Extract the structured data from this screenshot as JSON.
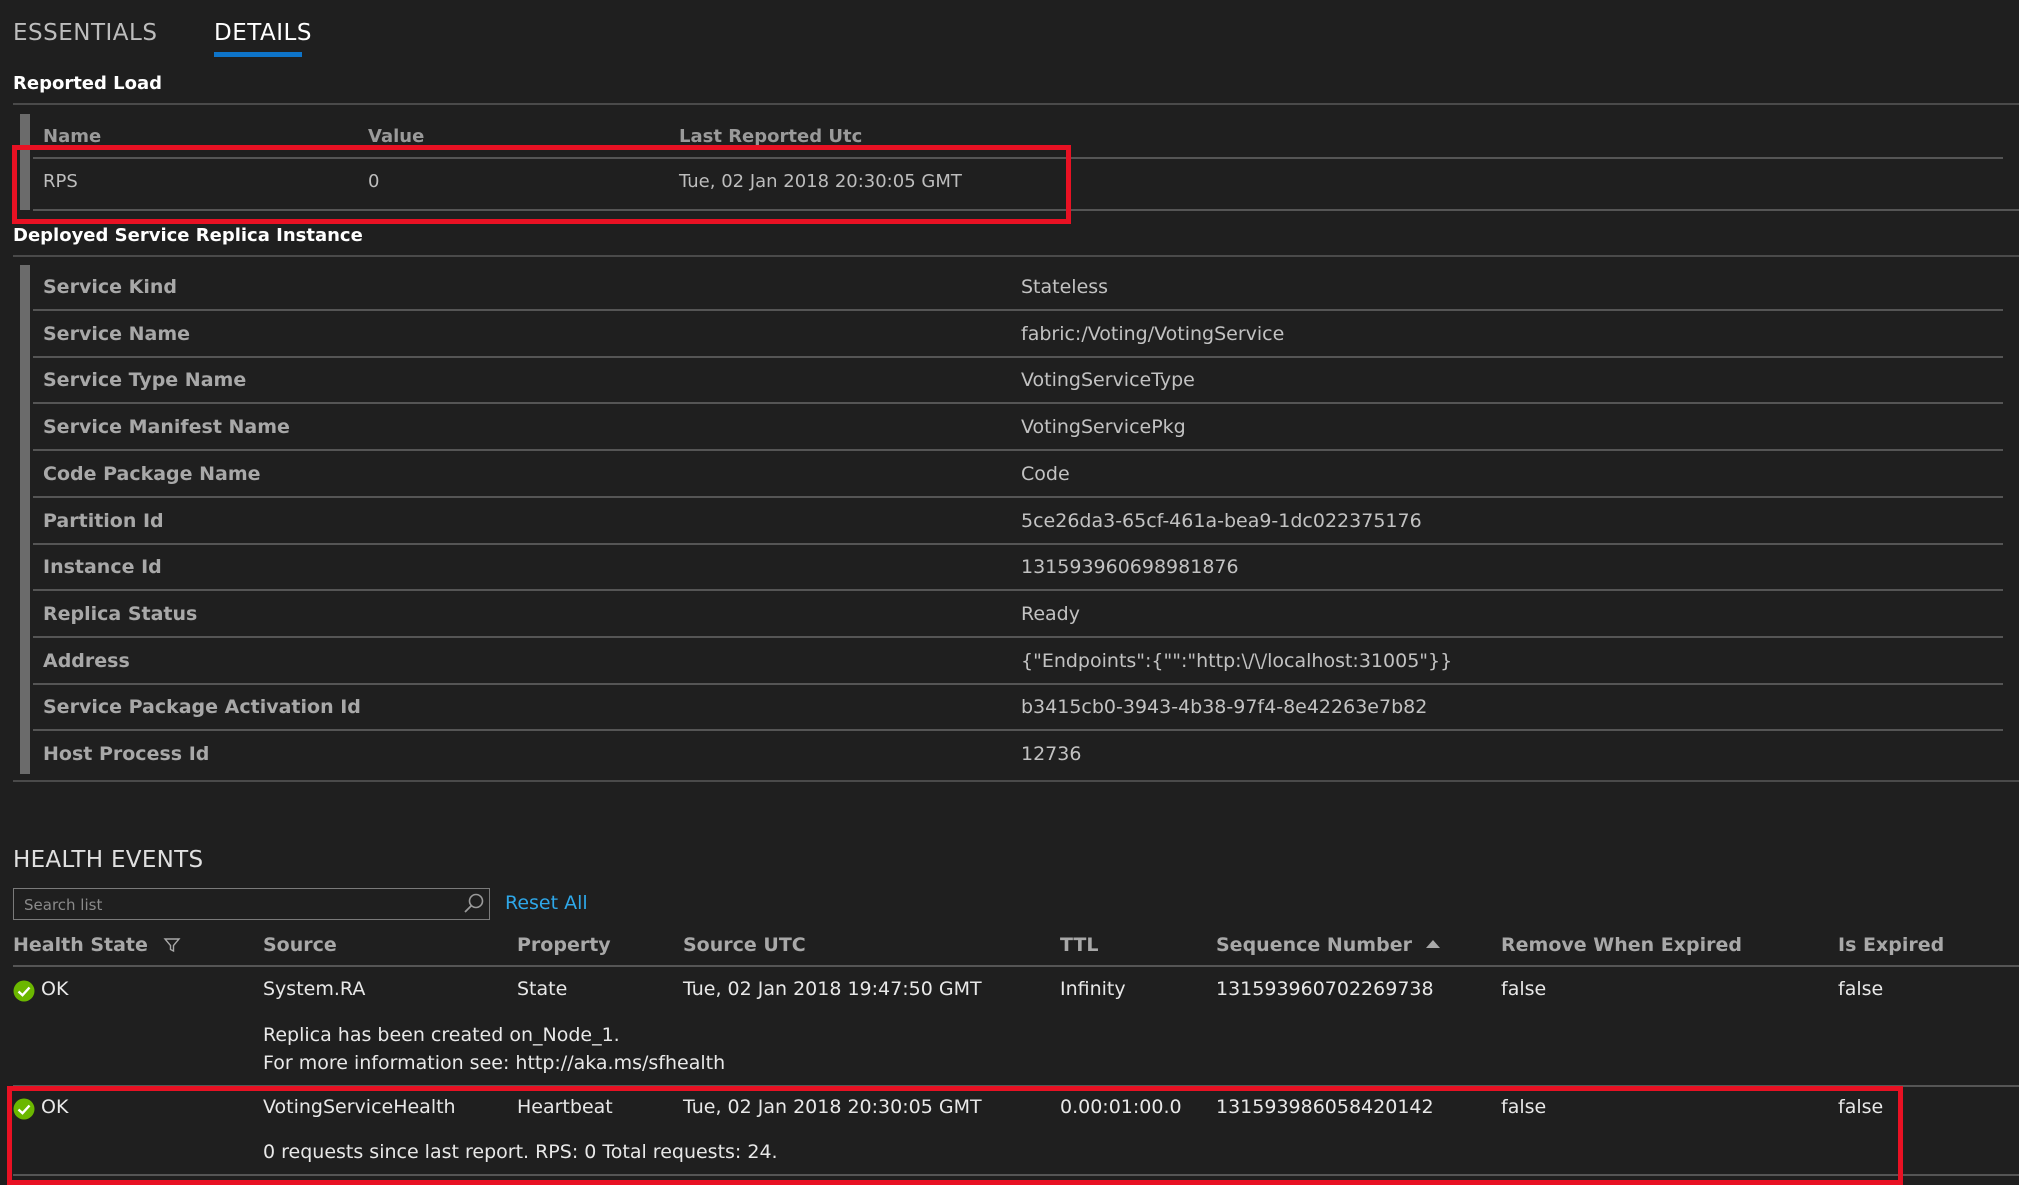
{
  "tabs": {
    "essentials": "ESSENTIALS",
    "details": "DETAILS"
  },
  "reported_load": {
    "title": "Reported Load",
    "headers": [
      "Name",
      "Value",
      "Last Reported Utc"
    ],
    "row": {
      "name": "RPS",
      "value": "0",
      "last_reported": "Tue, 02 Jan 2018 20:30:05 GMT"
    }
  },
  "replica": {
    "title": "Deployed Service Replica Instance",
    "rows": [
      {
        "key": "Service Kind",
        "value": "Stateless"
      },
      {
        "key": "Service Name",
        "value": "fabric:/Voting/VotingService"
      },
      {
        "key": "Service Type Name",
        "value": "VotingServiceType"
      },
      {
        "key": "Service Manifest Name",
        "value": "VotingServicePkg"
      },
      {
        "key": "Code Package Name",
        "value": "Code"
      },
      {
        "key": "Partition Id",
        "value": "5ce26da3-65cf-461a-bea9-1dc022375176"
      },
      {
        "key": "Instance Id",
        "value": "131593960698981876"
      },
      {
        "key": "Replica Status",
        "value": "Ready"
      },
      {
        "key": "Address",
        "value": "{\"Endpoints\":{\"\":\"http:\\/\\/localhost:31005\"}}"
      },
      {
        "key": "Service Package Activation Id",
        "value": "b3415cb0-3943-4b38-97f4-8e42263e7b82"
      },
      {
        "key": "Host Process Id",
        "value": "12736"
      }
    ]
  },
  "health_events": {
    "title": "HEALTH EVENTS",
    "search": {
      "placeholder": "Search list",
      "value": ""
    },
    "reset_all": "Reset All",
    "columns": [
      "Health State",
      "Source",
      "Property",
      "Source UTC",
      "TTL",
      "Sequence Number",
      "Remove When Expired",
      "Is Expired"
    ],
    "events": [
      {
        "health_state": "OK",
        "source": "System.RA",
        "property": "State",
        "source_utc": "Tue, 02 Jan 2018 19:47:50 GMT",
        "ttl": "Infinity",
        "sequence_number": "131593960702269738",
        "remove_when_expired": "false",
        "is_expired": "false",
        "description_lines": [
          "Replica has been created on_Node_1.",
          "For more information see: http://aka.ms/sfhealth"
        ]
      },
      {
        "health_state": "OK",
        "source": "VotingServiceHealth",
        "property": "Heartbeat",
        "source_utc": "Tue, 02 Jan 2018 20:30:05 GMT",
        "ttl": "0.00:01:00.0",
        "sequence_number": "131593986058420142",
        "remove_when_expired": "false",
        "is_expired": "false",
        "description_lines": [
          "0 requests since last report. RPS: 0 Total requests: 24."
        ]
      }
    ]
  },
  "colors": {
    "background": "#1f1f1f",
    "accent": "#0e74c9",
    "link": "#2ea7e8",
    "highlight_box": "#e81123",
    "ok_green": "#6bb700"
  },
  "icons": {
    "filter": "filter-icon",
    "sort": "sort-ascending-icon",
    "search": "search-icon",
    "ok": "ok-check-icon"
  }
}
